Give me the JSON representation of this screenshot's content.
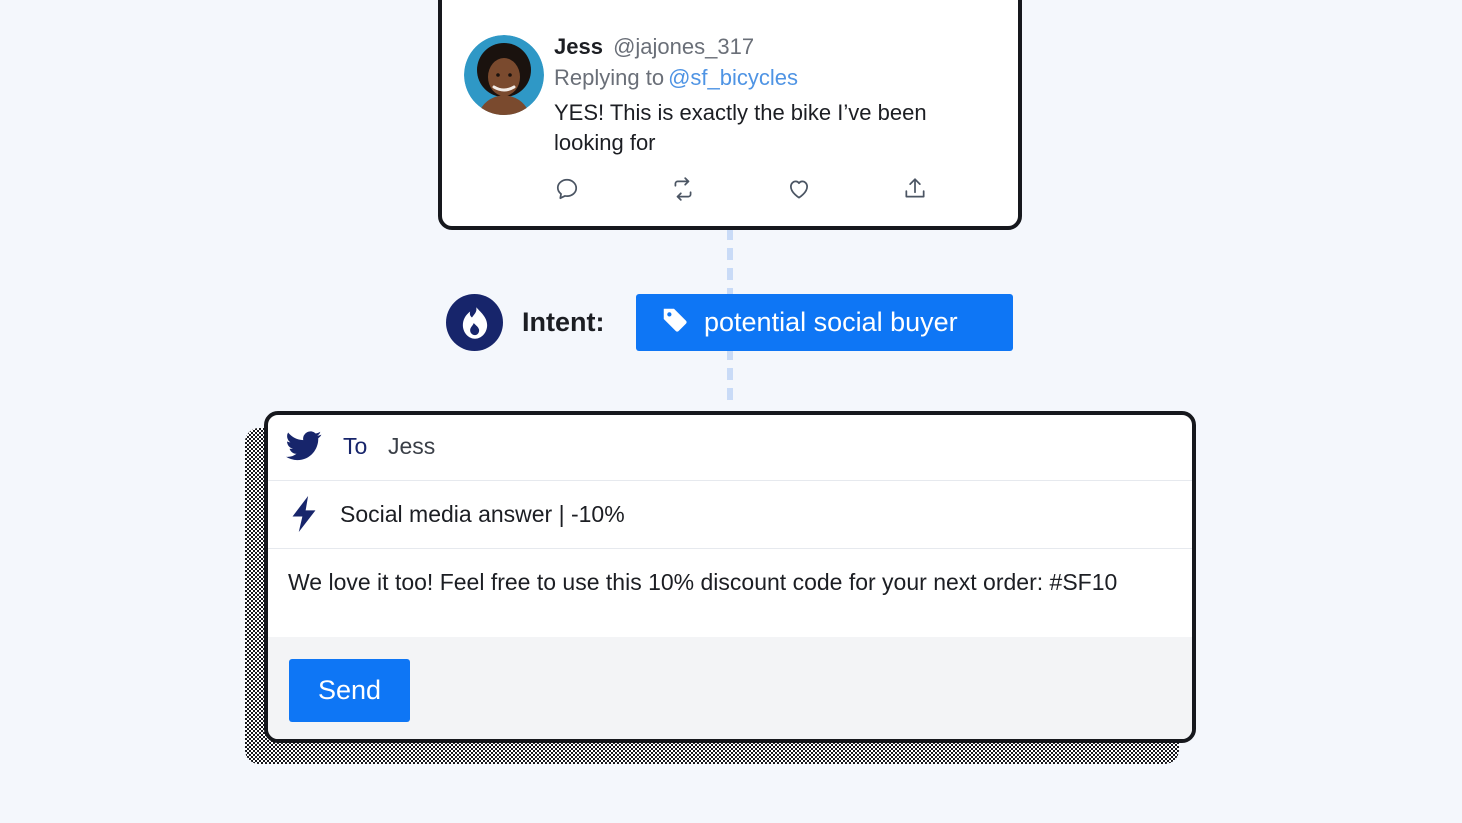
{
  "tweet": {
    "author_name": "Jess",
    "author_handle": "@jajones_317",
    "replying_prefix": "Replying to",
    "replying_to": "@sf_bicycles",
    "text": "YES! This is exactly the bike I’ve been looking for",
    "actions": [
      "reply-icon",
      "retweet-icon",
      "heart-icon",
      "share-icon"
    ]
  },
  "intent": {
    "label": "Intent:",
    "tag": "potential social buyer",
    "icon": "flame-icon"
  },
  "composer": {
    "to_label": "To",
    "to_value": "Jess",
    "macro": "Social media answer | -10%",
    "message": "We love it too! Feel free to use this 10% discount code for your next order: #SF10",
    "send_label": "Send"
  },
  "colors": {
    "accent": "#0e76f5",
    "navy": "#17256b",
    "link": "#4f94e4",
    "background": "#f4f7fc"
  }
}
